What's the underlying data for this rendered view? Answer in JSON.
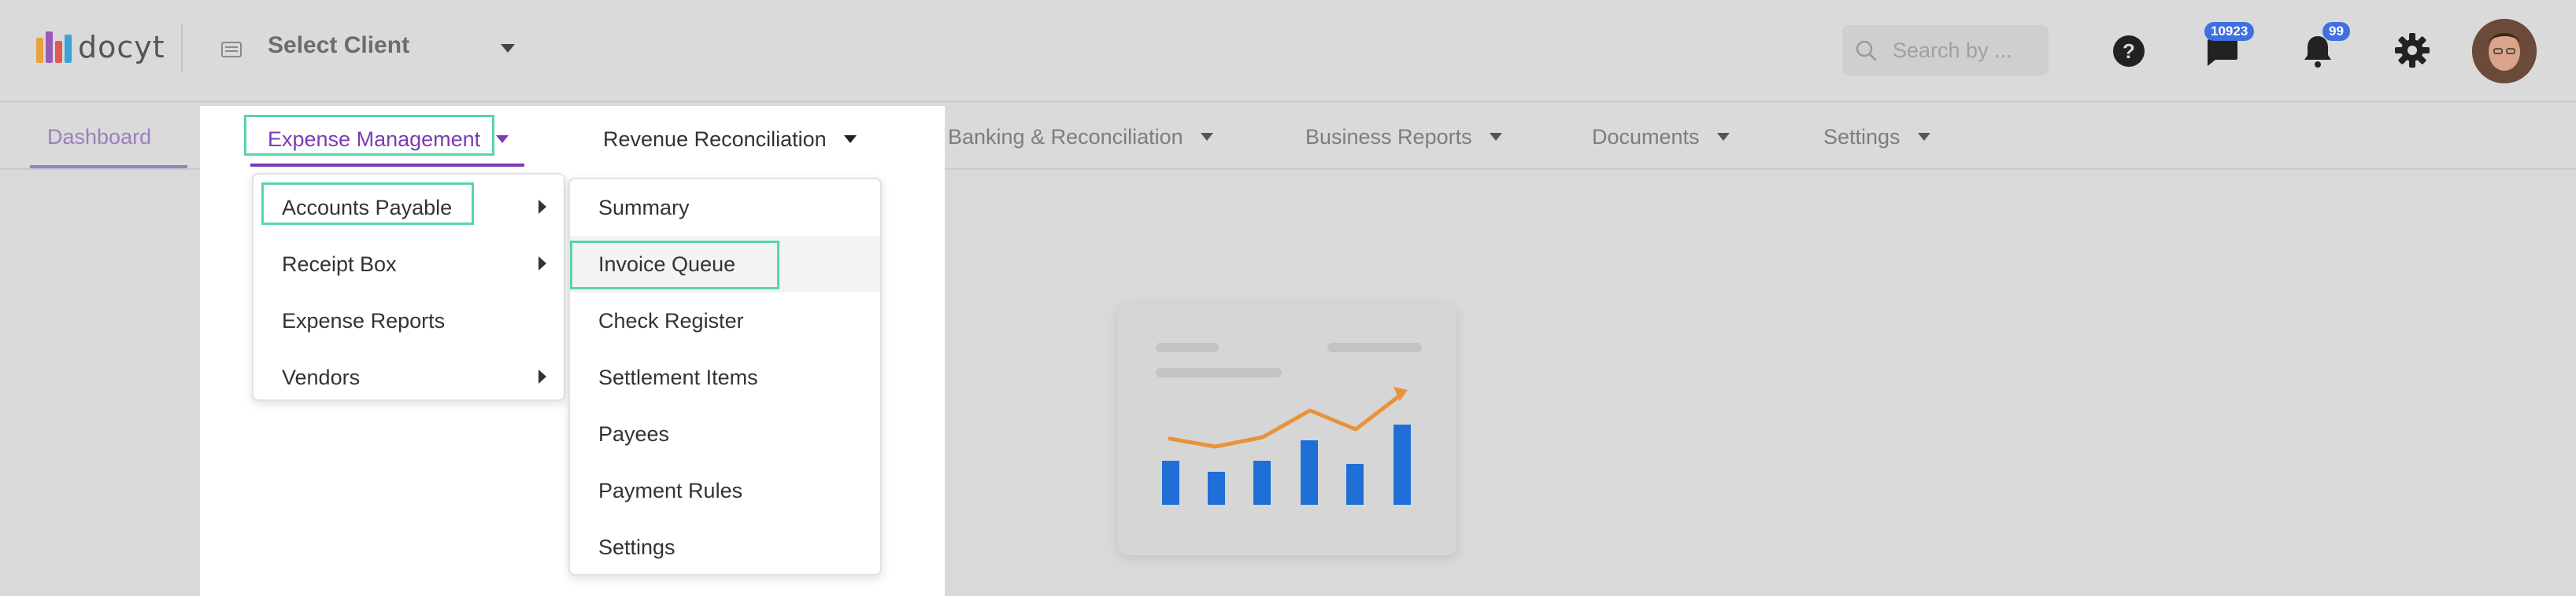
{
  "header": {
    "logo_text": "docyt",
    "client_select_label": "Select Client",
    "search_placeholder": "Search by ...",
    "messages_badge": "10923",
    "notifications_badge": "99",
    "icons": [
      "help-icon",
      "chat-icon",
      "bell-icon",
      "gear-icon",
      "search-icon"
    ]
  },
  "nav": {
    "items": [
      {
        "label": "Dashboard"
      },
      {
        "label": "Expense Management"
      },
      {
        "label": "Revenue Reconciliation"
      },
      {
        "label": "Banking & Reconciliation"
      },
      {
        "label": "Business Reports"
      },
      {
        "label": "Documents"
      },
      {
        "label": "Settings"
      }
    ]
  },
  "expense_menu": {
    "items": [
      {
        "label": "Accounts Payable",
        "has_submenu": true
      },
      {
        "label": "Receipt Box",
        "has_submenu": true
      },
      {
        "label": "Expense Reports",
        "has_submenu": false
      },
      {
        "label": "Vendors",
        "has_submenu": true
      }
    ]
  },
  "accounts_payable_menu": {
    "items": [
      {
        "label": "Summary"
      },
      {
        "label": "Invoice Queue"
      },
      {
        "label": "Check Register"
      },
      {
        "label": "Settlement Items"
      },
      {
        "label": "Payees"
      },
      {
        "label": "Payment Rules"
      },
      {
        "label": "Settings"
      }
    ]
  },
  "colors": {
    "accent_purple": "#7b3bb5",
    "highlight_green": "#57d6a8",
    "badge_blue": "#3f6fe0",
    "chart_bar_blue": "#1f6fd6",
    "chart_line_orange": "#e8933a"
  }
}
